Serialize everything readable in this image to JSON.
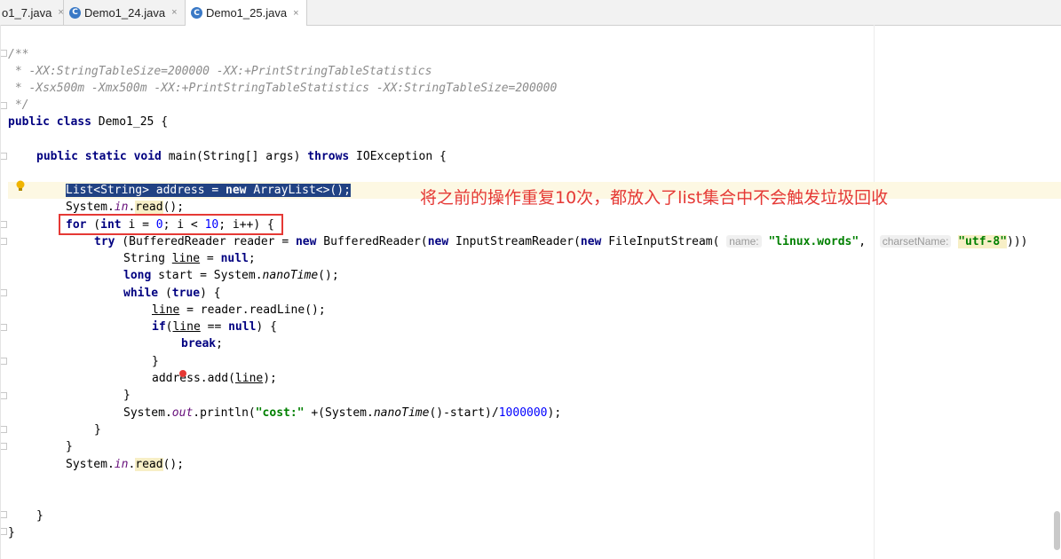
{
  "tabs": [
    {
      "label": "o1_7.java",
      "close": "×"
    },
    {
      "label": "Demo1_24.java",
      "close": "×"
    },
    {
      "label": "Demo1_25.java",
      "close": "×"
    }
  ],
  "annotation": {
    "text": "将之前的操作重复10次，都放入了list集合中不会触发垃圾回收"
  },
  "code": {
    "l1": "/**",
    "l2": " * -XX:StringTableSize=200000 -XX:+PrintStringTableStatistics",
    "l3": " * -Xsx500m -Xmx500m -XX:+PrintStringTableStatistics -XX:StringTableSize=200000",
    "l4": " */",
    "l5_kw": "public class",
    "l5_rest": " Demo1_25 {",
    "l7_kw": "public static void",
    "l7_a": " main(String[] args) ",
    "l7_kw2": "throws",
    "l7_b": " IOException {",
    "l9_a": "List<String> address = ",
    "l9_kw": "new",
    "l9_b": " ArrayList<>();",
    "l10_a": "System.",
    "l10_f": "in",
    "l10_dot": ".",
    "l10_m": "read",
    "l10_b": "();",
    "l11_kw": "for",
    "l11_a": " (",
    "l11_kw2": "int",
    "l11_b": " i = ",
    "l11_n0": "0",
    "l11_c": "; i < ",
    "l11_n10": "10",
    "l11_d": "; i++) {",
    "l12_kw": "try",
    "l12_a": " (BufferedReader reader = ",
    "l12_kw2": "new",
    "l12_b": " BufferedReader(",
    "l12_kw3": "new",
    "l12_c": " InputStreamReader(",
    "l12_kw4": "new",
    "l12_d": " FileInputStream( ",
    "l12_h1": "name:",
    "l12_s1": "\"linux.words\"",
    "l12_e": ",  ",
    "l12_h2": "charsetName:",
    "l12_s2": "\"utf-8\"",
    "l12_f": ")))",
    "l13_a": "String ",
    "l13_v": "line",
    "l13_b": " = ",
    "l13_kw": "null",
    "l13_c": ";",
    "l14_kw": "long",
    "l14_a": " start = System.",
    "l14_m": "nanoTime",
    "l14_b": "();",
    "l15_kw": "while",
    "l15_a": " (",
    "l15_kw2": "true",
    "l15_b": ") {",
    "l16_v": "line",
    "l16_a": " = reader.readLine();",
    "l17_kw": "if",
    "l17_a": "(",
    "l17_v": "line",
    "l17_b": " == ",
    "l17_kw2": "null",
    "l17_c": ") {",
    "l18_kw": "break",
    "l18_a": ";",
    "l19": "}",
    "l20_a": "address.add(",
    "l20_v": "line",
    "l20_b": ");",
    "l21": "}",
    "l22_a": "System.",
    "l22_f": "out",
    "l22_b": ".println(",
    "l22_s": "\"cost:\"",
    "l22_c": " +(System.",
    "l22_m": "nanoTime",
    "l22_d": "()-start)/",
    "l22_n": "1000000",
    "l22_e": ");",
    "l23": "}",
    "l24": "}",
    "l25_a": "System.",
    "l25_f": "in",
    "l25_dot": ".",
    "l25_m": "read",
    "l25_b": "();",
    "l28": "}",
    "l29": "}"
  }
}
